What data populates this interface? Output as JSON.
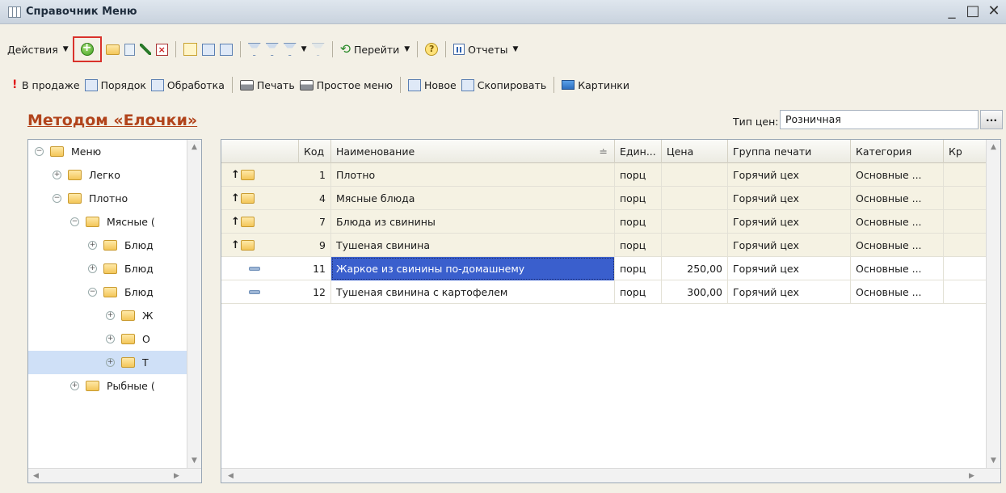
{
  "window": {
    "title": "Справочник Меню",
    "controls": [
      "_",
      "□",
      "✕"
    ]
  },
  "toolbar1": {
    "actions_label": "Действия",
    "goto_label": "Перейти",
    "reports_label": "Отчеты"
  },
  "toolbar2": {
    "on_sale": "В продаже",
    "order": "Порядок",
    "processing": "Обработка",
    "print": "Печать",
    "simple_menu": "Простое меню",
    "new": "Новое",
    "copy": "Скопировать",
    "pictures": "Картинки"
  },
  "heading": "Методом «Елочки»",
  "price_type": {
    "label": "Тип цен:",
    "value": "Розничная",
    "more": "..."
  },
  "tree": {
    "items": [
      {
        "label": "Меню",
        "exp": "−",
        "level": 0
      },
      {
        "label": "Легко",
        "exp": "+",
        "level": 1
      },
      {
        "label": "Плотно",
        "exp": "−",
        "level": 1
      },
      {
        "label": "Мясные (",
        "exp": "−",
        "level": 2
      },
      {
        "label": "Блюд",
        "exp": "+",
        "level": 3
      },
      {
        "label": "Блюд",
        "exp": "+",
        "level": 3
      },
      {
        "label": "Блюд",
        "exp": "−",
        "level": 3
      },
      {
        "label": "Ж",
        "exp": "+",
        "level": 4
      },
      {
        "label": "О",
        "exp": "+",
        "level": 4
      },
      {
        "label": "Т",
        "exp": "+",
        "level": 4,
        "selected": true
      },
      {
        "label": "Рыбные (",
        "exp": "+",
        "level": 2
      }
    ]
  },
  "table": {
    "columns": [
      "Код",
      "Наименование",
      "Един...",
      "Цена",
      "Группа печати",
      "Категория",
      "Кр"
    ],
    "rows": [
      {
        "type": "group",
        "code": "1",
        "name": "Плотно",
        "unit": "порц",
        "price": "",
        "print_group": "Горячий цех",
        "category": "Основные ...",
        "kr": ""
      },
      {
        "type": "group",
        "code": "4",
        "name": "Мясные блюда",
        "unit": "порц",
        "price": "",
        "print_group": "Горячий цех",
        "category": "Основные ...",
        "kr": ""
      },
      {
        "type": "group",
        "code": "7",
        "name": "Блюда из свинины",
        "unit": "порц",
        "price": "",
        "print_group": "Горячий цех",
        "category": "Основные ...",
        "kr": ""
      },
      {
        "type": "group",
        "code": "9",
        "name": "Тушеная свинина",
        "unit": "порц",
        "price": "",
        "print_group": "Горячий цех",
        "category": "Основные ...",
        "kr": ""
      },
      {
        "type": "item",
        "code": "11",
        "name": "Жаркое из свинины по-домашнему",
        "unit": "порц",
        "price": "250,00",
        "print_group": "Горячий цех",
        "category": "Основные ...",
        "kr": "",
        "selected": true
      },
      {
        "type": "item",
        "code": "12",
        "name": "Тушеная свинина с картофелем",
        "unit": "порц",
        "price": "300,00",
        "print_group": "Горячий цех",
        "category": "Основные ...",
        "kr": ""
      }
    ]
  },
  "icons": [
    "add-icon",
    "add-folder-icon",
    "copy-icon",
    "edit-icon",
    "delete-icon",
    "hierarchy-icon",
    "filter-icon",
    "refresh-icon",
    "help-icon",
    "report-icon",
    "alert-icon",
    "order-icon",
    "processing-icon",
    "print-icon",
    "simple-menu-icon",
    "new-icon",
    "copy-doc-icon",
    "pictures-icon",
    "folder-icon"
  ],
  "colors": {
    "heading": "#b1441c",
    "highlight_frame": "#d9322b",
    "selection": "#3a5fcd"
  }
}
